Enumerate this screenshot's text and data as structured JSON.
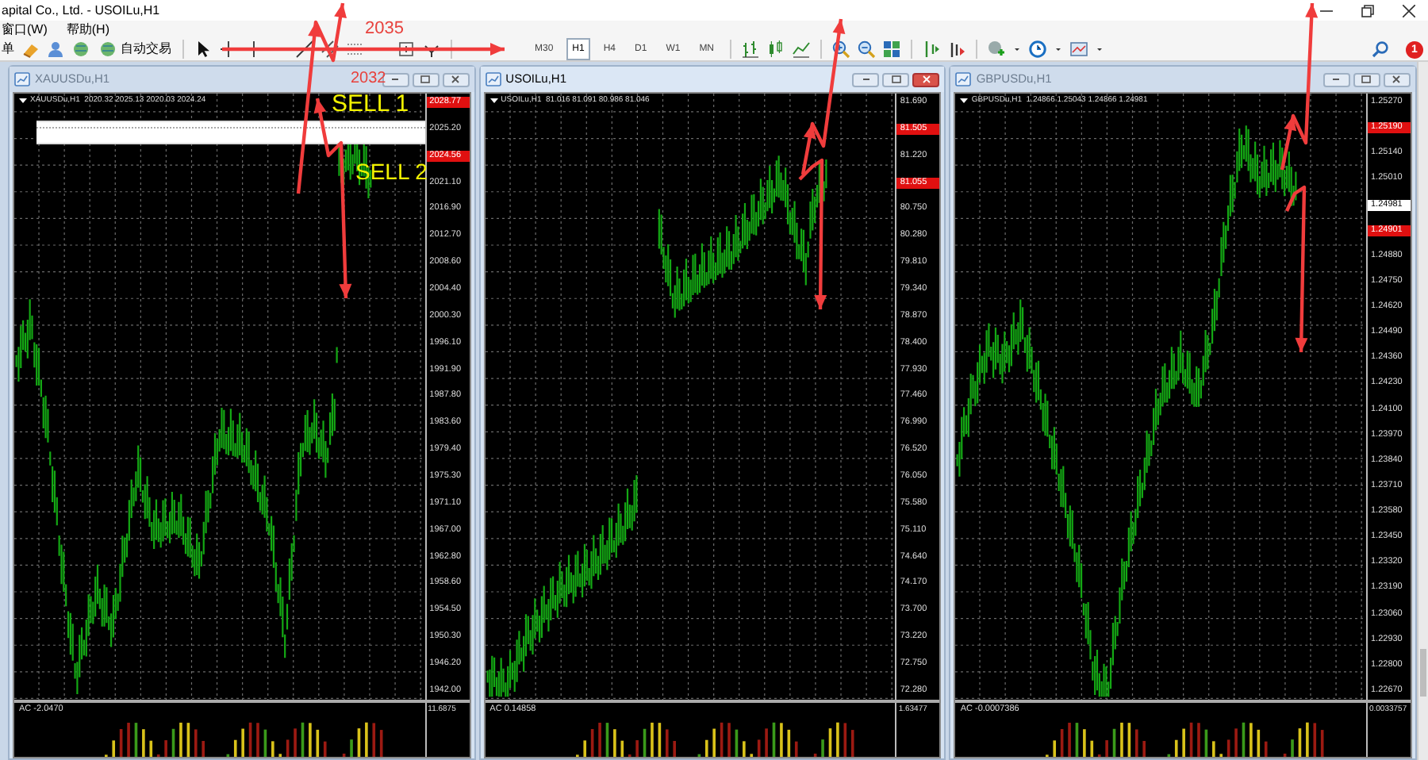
{
  "window": {
    "title": "apital Co., Ltd. - USOILu,H1"
  },
  "menu": [
    {
      "label": "窗口(W)"
    },
    {
      "label": "帮助(H)"
    }
  ],
  "toolbar": {
    "cut_label": "单",
    "autotrade_label": "自动交易",
    "timeframes": [
      {
        "label": "M30",
        "selected": false
      },
      {
        "label": "H1",
        "selected": true
      },
      {
        "label": "H4",
        "selected": false
      },
      {
        "label": "D1",
        "selected": false
      },
      {
        "label": "W1",
        "selected": false
      },
      {
        "label": "MN",
        "selected": false
      }
    ],
    "notifications": "1"
  },
  "annotations": [
    {
      "text": "2035",
      "color": "#e8413c"
    },
    {
      "text": "2032",
      "color": "#e8413c"
    },
    {
      "text": "SELL 1",
      "color": "#f2f200"
    },
    {
      "text": "SELL 2",
      "color": "#f2f200"
    }
  ],
  "charts": [
    {
      "title": "XAUUSDu,H1",
      "active": false,
      "info": "XAUUSDu,H1  2020.32 2025.13 2020.03 2024.24",
      "highlight_zone": true,
      "axis": [
        {
          "text": "2028.77",
          "kind": "level"
        },
        {
          "text": "2025.20",
          "kind": "tick"
        },
        {
          "text": "2024.56",
          "kind": "level"
        },
        {
          "text": "2021.10",
          "kind": "tick"
        },
        {
          "text": "2016.90",
          "kind": "tick"
        },
        {
          "text": "2012.70",
          "kind": "tick"
        },
        {
          "text": "2008.60",
          "kind": "tick"
        },
        {
          "text": "2004.40",
          "kind": "tick"
        },
        {
          "text": "2000.30",
          "kind": "tick"
        },
        {
          "text": "1996.10",
          "kind": "tick"
        },
        {
          "text": "1991.90",
          "kind": "tick"
        },
        {
          "text": "1987.80",
          "kind": "tick"
        },
        {
          "text": "1983.60",
          "kind": "tick"
        },
        {
          "text": "1979.40",
          "kind": "tick"
        },
        {
          "text": "1975.30",
          "kind": "tick"
        },
        {
          "text": "1971.10",
          "kind": "tick"
        },
        {
          "text": "1967.00",
          "kind": "tick"
        },
        {
          "text": "1962.80",
          "kind": "tick"
        },
        {
          "text": "1958.60",
          "kind": "tick"
        },
        {
          "text": "1954.50",
          "kind": "tick"
        },
        {
          "text": "1950.30",
          "kind": "tick"
        },
        {
          "text": "1946.20",
          "kind": "tick"
        },
        {
          "text": "1942.00",
          "kind": "tick"
        }
      ],
      "indicator": {
        "label": "AC -2.0470",
        "max": "11.6875"
      }
    },
    {
      "title": "USOILu,H1",
      "active": true,
      "info": "USOILu,H1  81.016 81.091 80.986 81.046",
      "highlight_zone": false,
      "axis": [
        {
          "text": "81.690",
          "kind": "tick"
        },
        {
          "text": "81.505",
          "kind": "level"
        },
        {
          "text": "81.220",
          "kind": "tick"
        },
        {
          "text": "81.055",
          "kind": "level"
        },
        {
          "text": "80.750",
          "kind": "tick"
        },
        {
          "text": "80.280",
          "kind": "tick"
        },
        {
          "text": "79.810",
          "kind": "tick"
        },
        {
          "text": "79.340",
          "kind": "tick"
        },
        {
          "text": "78.870",
          "kind": "tick"
        },
        {
          "text": "78.400",
          "kind": "tick"
        },
        {
          "text": "77.930",
          "kind": "tick"
        },
        {
          "text": "77.460",
          "kind": "tick"
        },
        {
          "text": "76.990",
          "kind": "tick"
        },
        {
          "text": "76.520",
          "kind": "tick"
        },
        {
          "text": "76.050",
          "kind": "tick"
        },
        {
          "text": "75.580",
          "kind": "tick"
        },
        {
          "text": "75.110",
          "kind": "tick"
        },
        {
          "text": "74.640",
          "kind": "tick"
        },
        {
          "text": "74.170",
          "kind": "tick"
        },
        {
          "text": "73.700",
          "kind": "tick"
        },
        {
          "text": "73.220",
          "kind": "tick"
        },
        {
          "text": "72.750",
          "kind": "tick"
        },
        {
          "text": "72.280",
          "kind": "tick"
        }
      ],
      "indicator": {
        "label": "AC 0.14858",
        "max": "1.63477"
      }
    },
    {
      "title": "GBPUSDu,H1",
      "active": false,
      "info": "GBPUSDu,H1  1.24866 1.25043 1.24866 1.24981",
      "highlight_zone": false,
      "axis": [
        {
          "text": "1.25270",
          "kind": "tick"
        },
        {
          "text": "1.25190",
          "kind": "level"
        },
        {
          "text": "1.25140",
          "kind": "tick"
        },
        {
          "text": "1.25010",
          "kind": "tick"
        },
        {
          "text": "1.24981",
          "kind": "bid"
        },
        {
          "text": "1.24901",
          "kind": "level"
        },
        {
          "text": "1.24880",
          "kind": "tick"
        },
        {
          "text": "1.24750",
          "kind": "tick"
        },
        {
          "text": "1.24620",
          "kind": "tick"
        },
        {
          "text": "1.24490",
          "kind": "tick"
        },
        {
          "text": "1.24360",
          "kind": "tick"
        },
        {
          "text": "1.24230",
          "kind": "tick"
        },
        {
          "text": "1.24100",
          "kind": "tick"
        },
        {
          "text": "1.23970",
          "kind": "tick"
        },
        {
          "text": "1.23840",
          "kind": "tick"
        },
        {
          "text": "1.23710",
          "kind": "tick"
        },
        {
          "text": "1.23580",
          "kind": "tick"
        },
        {
          "text": "1.23450",
          "kind": "tick"
        },
        {
          "text": "1.23320",
          "kind": "tick"
        },
        {
          "text": "1.23190",
          "kind": "tick"
        },
        {
          "text": "1.23060",
          "kind": "tick"
        },
        {
          "text": "1.22930",
          "kind": "tick"
        },
        {
          "text": "1.22800",
          "kind": "tick"
        },
        {
          "text": "1.22670",
          "kind": "tick"
        }
      ],
      "indicator": {
        "label": "AC -0.0007386",
        "max": "0.0033757"
      }
    }
  ]
}
